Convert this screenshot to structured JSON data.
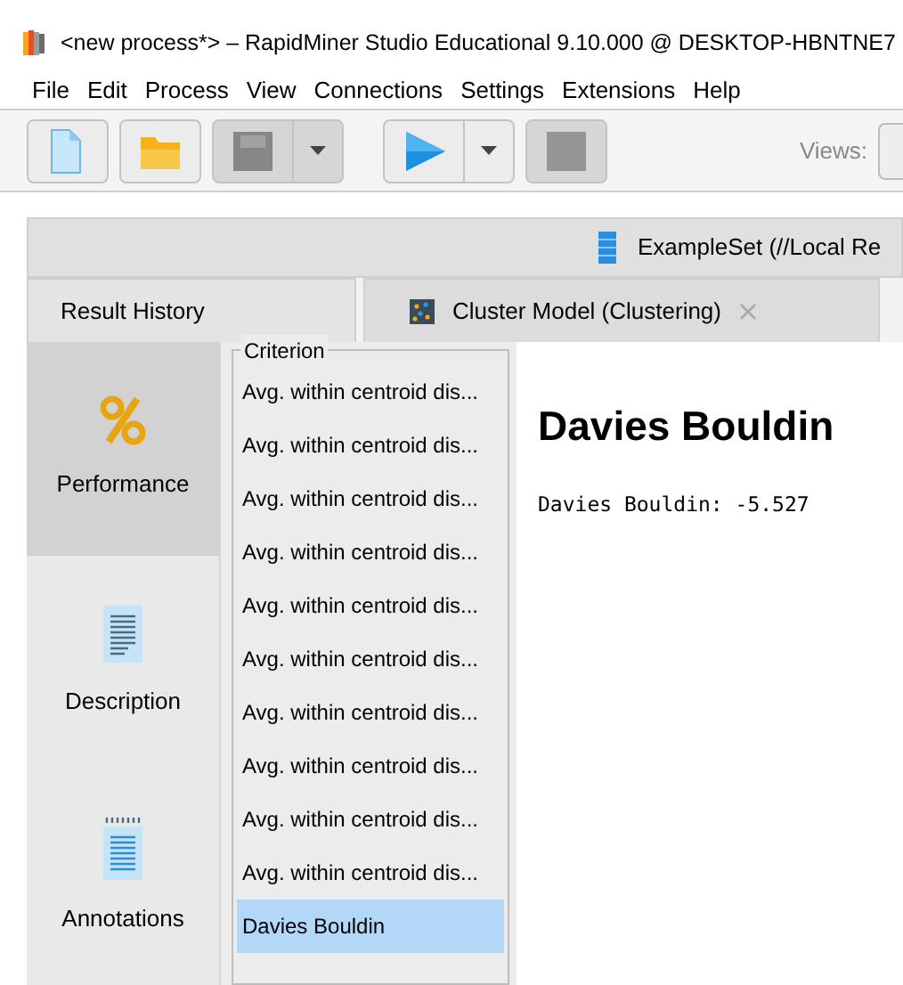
{
  "window": {
    "title": "<new process*> – RapidMiner Studio Educational 9.10.000 @ DESKTOP-HBNTNE7"
  },
  "menu": [
    "File",
    "Edit",
    "Process",
    "View",
    "Connections",
    "Settings",
    "Extensions",
    "Help"
  ],
  "toolbar": {
    "buttons": [
      {
        "kind": "new",
        "disabled": false
      },
      {
        "kind": "open",
        "disabled": false
      },
      {
        "kind": "save",
        "disabled": true
      },
      {
        "kind": "run",
        "disabled": false
      },
      {
        "kind": "stop",
        "disabled": true
      }
    ],
    "views_label": "Views:"
  },
  "result_bar": {
    "title": "ExampleSet (//Local Re"
  },
  "tabs": [
    {
      "label": "Result History",
      "selected": false,
      "closable": false
    },
    {
      "label": "Cluster Model (Clustering)",
      "selected": true,
      "closable": true
    }
  ],
  "side_views": [
    {
      "kind": "performance",
      "label": "Performance",
      "selected": true
    },
    {
      "kind": "description",
      "label": "Description",
      "selected": false
    },
    {
      "kind": "annotations",
      "label": "Annotations",
      "selected": false
    }
  ],
  "criterion": {
    "title": "Criterion",
    "items": [
      {
        "label": "Avg. within centroid dis...",
        "selected": false
      },
      {
        "label": "Avg. within centroid dis...",
        "selected": false
      },
      {
        "label": "Avg. within centroid dis...",
        "selected": false
      },
      {
        "label": "Avg. within centroid dis...",
        "selected": false
      },
      {
        "label": "Avg. within centroid dis...",
        "selected": false
      },
      {
        "label": "Avg. within centroid dis...",
        "selected": false
      },
      {
        "label": "Avg. within centroid dis...",
        "selected": false
      },
      {
        "label": "Avg. within centroid dis...",
        "selected": false
      },
      {
        "label": "Avg. within centroid dis...",
        "selected": false
      },
      {
        "label": "Avg. within centroid dis...",
        "selected": false
      },
      {
        "label": "Davies Bouldin",
        "selected": true
      }
    ]
  },
  "detail": {
    "heading": "Davies Bouldin",
    "value": "Davies Bouldin: -5.527"
  }
}
